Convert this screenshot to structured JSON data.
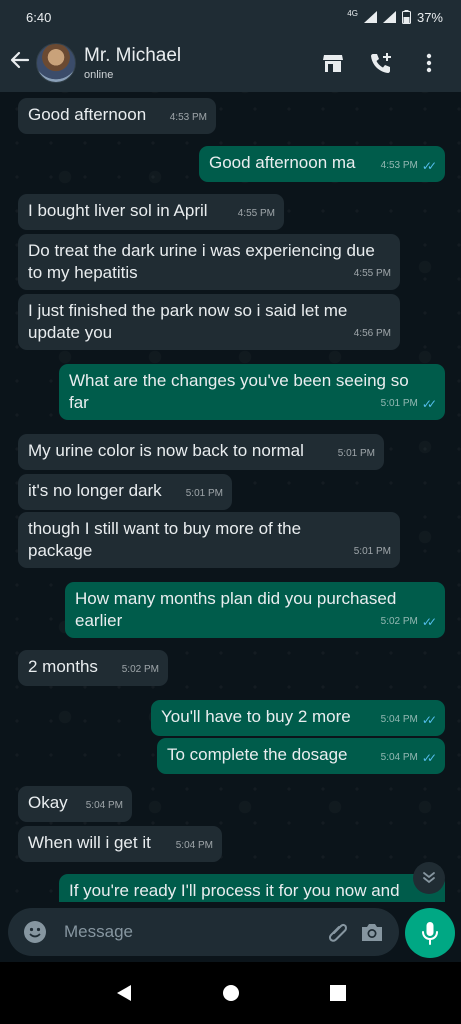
{
  "status": {
    "time": "6:40",
    "network": "4G",
    "battery": "37%"
  },
  "contact": {
    "name": "Mr. Michael",
    "presence": "online"
  },
  "messages": [
    {
      "dir": "in",
      "text": "Good afternoon",
      "time": "4:53 PM"
    },
    {
      "dir": "out",
      "text": "Good afternoon ma",
      "time": "4:53 PM",
      "read": true
    },
    {
      "dir": "in",
      "text": "I bought liver sol in April",
      "time": "4:55 PM"
    },
    {
      "dir": "in",
      "text": "Do treat the dark urine i was experiencing due\nto my hepatitis",
      "time": "4:55 PM"
    },
    {
      "dir": "in",
      "text": "I just finished the park now so i said let me\nupdate you",
      "time": "4:56 PM"
    },
    {
      "dir": "out",
      "text": "What are the changes you've been seeing so\nfar",
      "time": "5:01 PM",
      "read": true
    },
    {
      "dir": "in",
      "text": "My urine color is now back to normal",
      "time": "5:01 PM"
    },
    {
      "dir": "in",
      "text": "it's no longer dark",
      "time": "5:01 PM"
    },
    {
      "dir": "in",
      "text": "though I still want to buy more of the\npackage",
      "time": "5:01 PM"
    },
    {
      "dir": "out",
      "text": "How many months plan did you purchased\nearlier",
      "time": "5:02 PM",
      "read": true
    },
    {
      "dir": "in",
      "text": "2 months",
      "time": "5:02 PM"
    },
    {
      "dir": "out",
      "text": "You'll have to buy 2 more",
      "time": "5:04 PM",
      "read": true
    },
    {
      "dir": "out",
      "text": "To complete the dosage",
      "time": "5:04 PM",
      "read": true
    },
    {
      "dir": "in",
      "text": "Okay",
      "time": "5:04 PM"
    },
    {
      "dir": "in",
      "text": "When will i get it",
      "time": "5:04 PM"
    },
    {
      "dir": "out",
      "text": "If you're ready I'll process it for you now  and",
      "time": "",
      "read": false
    }
  ],
  "composer": {
    "placeholder": "Message"
  },
  "icons": {
    "back": "arrow-left-icon",
    "shop": "storefront-icon",
    "call": "add-call-icon",
    "menu": "more-vert-icon",
    "emoji": "emoji-icon",
    "attach": "paperclip-icon",
    "camera": "camera-icon",
    "mic": "mic-icon",
    "scroll": "double-chevron-down-icon",
    "nav_back": "triangle-back-icon",
    "nav_home": "circle-home-icon",
    "nav_recent": "square-recents-icon"
  },
  "colors": {
    "incoming": "#202c33",
    "outgoing": "#005c4b",
    "accent": "#00a884",
    "read_ticks": "#53bdeb"
  }
}
